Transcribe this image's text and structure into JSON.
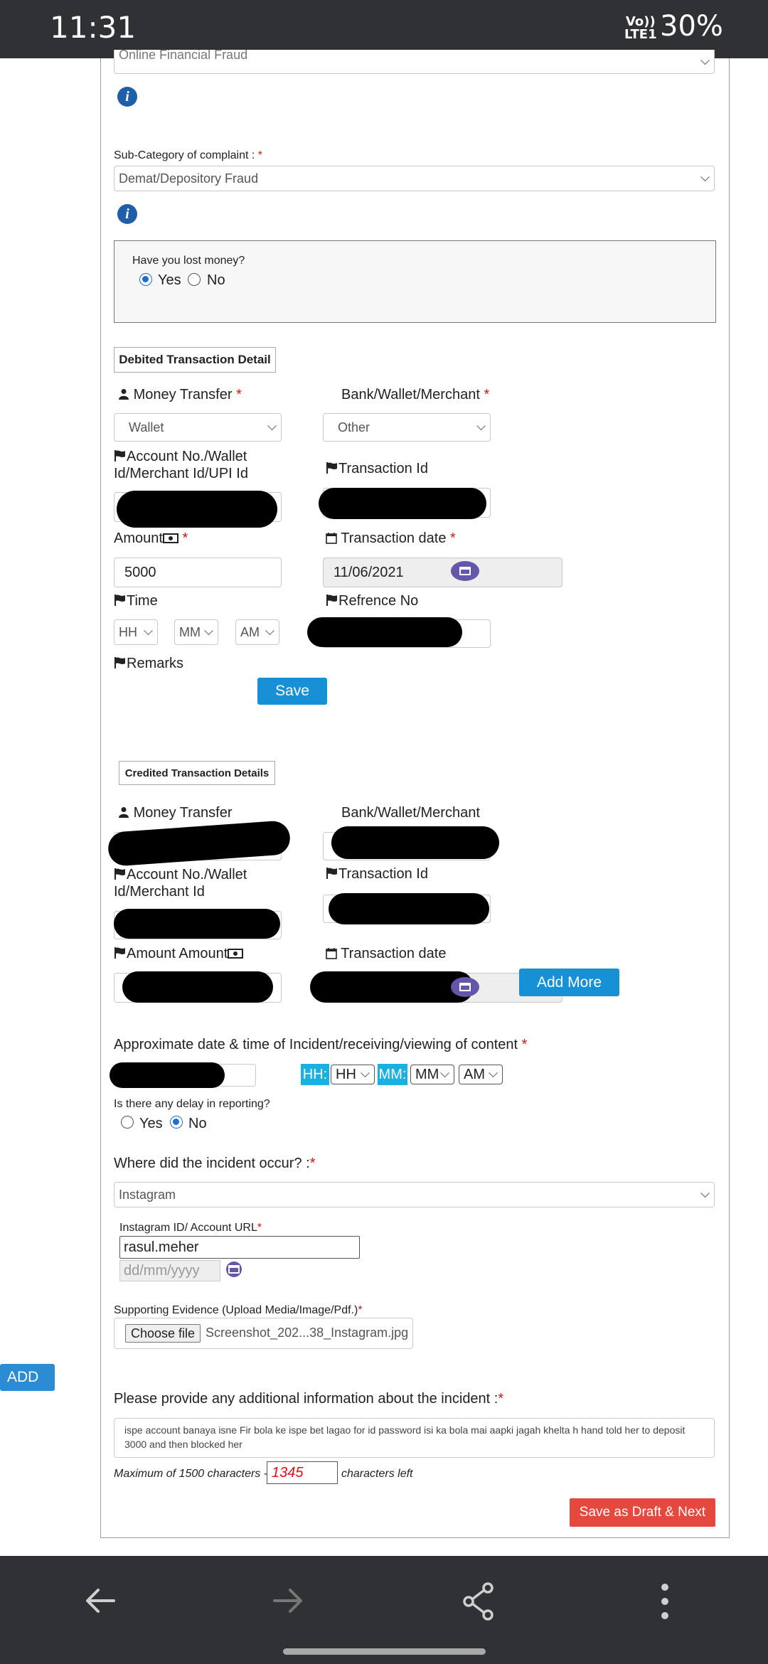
{
  "status": {
    "time": "11:31",
    "network_top": "Vo))",
    "network_bottom": "LTE1",
    "battery": "30%"
  },
  "form": {
    "category_value": "Online Financial Fraud",
    "subcategory_label": "Sub-Category of complaint :",
    "subcategory_value": "Demat/Depository Fraud",
    "lost_money_question": "Have you lost money?",
    "yes": "Yes",
    "no": "No",
    "debited": {
      "heading": "Debited Transaction Detail",
      "money_transfer_label": "Money Transfer",
      "money_transfer_value": "Wallet",
      "bank_label": "Bank/Wallet/Merchant",
      "bank_value": "Other",
      "account_label": "Account No./Wallet Id/Merchant Id/UPI Id",
      "transaction_id_label": "Transaction Id",
      "amount_label": "Amount",
      "amount_value": "5000",
      "transaction_date_label": "Transaction date",
      "transaction_date_value": "11/06/2021",
      "time_label": "Time",
      "hh": "HH",
      "mm": "MM",
      "ampm": "AM",
      "reference_label": "Refrence No",
      "remarks_label": "Remarks",
      "save_button": "Save"
    },
    "credited": {
      "heading": "Credited Transaction Details",
      "money_transfer_label": "Money Transfer",
      "bank_label": "Bank/Wallet/Merchant",
      "account_label": "Account No./Wallet Id/Merchant Id",
      "transaction_id_label": "Transaction Id",
      "amount_label": "Amount Amount",
      "transaction_date_label": "Transaction date",
      "add_more_button": "Add More"
    },
    "incident_datetime_label": "Approximate date & time of Incident/receiving/viewing of content",
    "hh_box": "HH:",
    "mm_box": "MM:",
    "hh_value": "HH",
    "mm_value": "MM",
    "ampm_value": "AM",
    "delay_question": "Is there any delay in reporting?",
    "where_label": "Where did the incident occur? :",
    "where_value": "Instagram",
    "instagram_label": "Instagram ID/ Account URL",
    "instagram_value": "rasul.meher",
    "date_placeholder": "dd/mm/yyyy",
    "evidence_label": "Supporting Evidence (Upload Media/Image/Pdf.)",
    "choose_file_button": "Choose file",
    "file_name": "Screenshot_202...38_Instagram.jpg",
    "add_button": "ADD",
    "additional_info_label": "Please provide any additional information about the incident :",
    "additional_info_text": "ispe account banaya isne Fir bola ke ispe bet lagao for id password isi ka bola mai aapki jagah khelta h hand told her to deposit 3000 and then blocked her",
    "max_chars_prefix": "Maximum of 1500 characters -",
    "chars_left_value": "1345",
    "max_chars_suffix": "characters left",
    "save_draft_button": "Save as Draft & Next"
  },
  "colors": {
    "accent_blue": "#1890d5",
    "danger_red": "#e5483d",
    "cyan": "#1ab0e0",
    "calendar_purple": "#6655a8"
  }
}
